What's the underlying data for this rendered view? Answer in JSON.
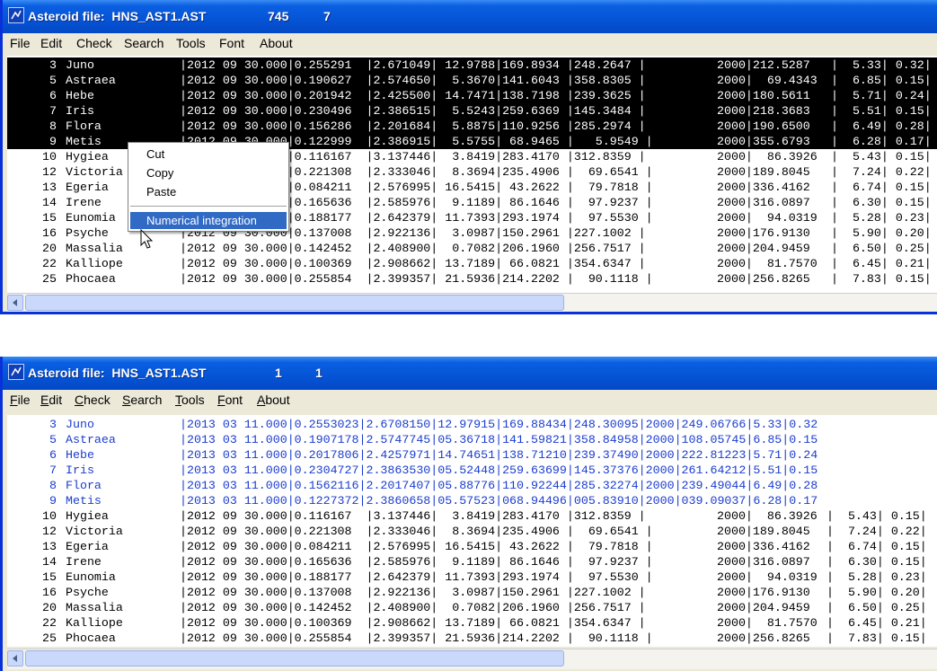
{
  "window_top": {
    "title": "Asteroid file:  HNS_AST1.AST",
    "num1": "745",
    "num2": "7",
    "menu": [
      "File",
      "Edit",
      "Check",
      "Search",
      "Tools",
      "Font",
      "About"
    ],
    "rows": [
      {
        "num": "3",
        "name": "Juno",
        "data": "|2012 09 30.000|0.255291  |2.671049| 12.9788|169.8934 |248.2647 |",
        "r1": "2000|212.5287",
        "r2": "|  5.33| 0.32|"
      },
      {
        "num": "5",
        "name": "Astraea",
        "data": "|2012 09 30.000|0.190627  |2.574650|  5.3670|141.6043 |358.8305 |",
        "r1": "2000|  69.4343",
        "r2": "|  6.85| 0.15|"
      },
      {
        "num": "6",
        "name": "Hebe",
        "data": "|2012 09 30.000|0.201942  |2.425500| 14.7471|138.7198 |239.3625 |",
        "r1": "2000|180.5611",
        "r2": "|  5.71| 0.24|"
      },
      {
        "num": "7",
        "name": "Iris",
        "data": "|2012 09 30.000|0.230496  |2.386515|  5.5243|259.6369 |145.3484 |",
        "r1": "2000|218.3683",
        "r2": "|  5.51| 0.15|"
      },
      {
        "num": "8",
        "name": "Flora",
        "data": "|2012 09 30.000|0.156286  |2.201684|  5.8875|110.9256 |285.2974 |",
        "r1": "2000|190.6500",
        "r2": "|  6.49| 0.28|"
      },
      {
        "num": "9",
        "name": "Metis",
        "data": "|2012 09 30.000|0.122999  |2.386915|  5.5755| 68.9465 |   5.9549 |",
        "r1": "2000|355.6793",
        "r2": "|  6.28| 0.17|"
      },
      {
        "num": "10",
        "name": "Hygiea",
        "data": "|2012 09 30.000|0.116167  |3.137446|  3.8419|283.4170 |312.8359 |",
        "r1": "2000|  86.3926",
        "r2": "|  5.43| 0.15|"
      },
      {
        "num": "12",
        "name": "Victoria",
        "data": "|2012 09 30.000|0.221308  |2.333046|  8.3694|235.4906 |  69.6541 |",
        "r1": "2000|189.8045",
        "r2": "|  7.24| 0.22|"
      },
      {
        "num": "13",
        "name": "Egeria",
        "data": "|2012 09 30.000|0.084211  |2.576995| 16.5415| 43.2622 |  79.7818 |",
        "r1": "2000|336.4162",
        "r2": "|  6.74| 0.15|"
      },
      {
        "num": "14",
        "name": "Irene",
        "data": "|2012 09 30.000|0.165636  |2.585976|  9.1189| 86.1646 |  97.9237 |",
        "r1": "2000|316.0897",
        "r2": "|  6.30| 0.15|"
      },
      {
        "num": "15",
        "name": "Eunomia",
        "data": "|2012 09 30.000|0.188177  |2.642379| 11.7393|293.1974 |  97.5530 |",
        "r1": "2000|  94.0319",
        "r2": "|  5.28| 0.23|"
      },
      {
        "num": "16",
        "name": "Psyche",
        "data": "|2012 09 30.000|0.137008  |2.922136|  3.0987|150.2961 |227.1002 |",
        "r1": "2000|176.9130",
        "r2": "|  5.90| 0.20|"
      },
      {
        "num": "20",
        "name": "Massalia",
        "data": "|2012 09 30.000|0.142452  |2.408900|  0.7082|206.1960 |256.7517 |",
        "r1": "2000|204.9459",
        "r2": "|  6.50| 0.25|"
      },
      {
        "num": "22",
        "name": "Kalliope",
        "data": "|2012 09 30.000|0.100369  |2.908662| 13.7189| 66.0821 |354.6347 |",
        "r1": "2000|  81.7570",
        "r2": "|  6.45| 0.21|"
      },
      {
        "num": "25",
        "name": "Phocaea",
        "data": "|2012 09 30.000|0.255854  |2.399357| 21.5936|214.2202 |  90.1118 |",
        "r1": "2000|256.8265",
        "r2": "|  7.83| 0.15|"
      }
    ],
    "context_menu": {
      "items": [
        "Cut",
        "Copy",
        "Paste"
      ],
      "highlighted": "Numerical integration"
    }
  },
  "window_bottom": {
    "title": "Asteroid file:  HNS_AST1.AST",
    "num1": "1",
    "num2": "1",
    "menu": [
      "File",
      "Edit",
      "Check",
      "Search",
      "Tools",
      "Font",
      "About"
    ],
    "rows": [
      {
        "num": "3",
        "name": "Juno",
        "data": "|2013 03 11.000|0.2553023|2.6708150|12.97915|169.88434|248.30095|2000|249.06766|5.33|0.32"
      },
      {
        "num": "5",
        "name": "Astraea",
        "data": "|2013 03 11.000|0.1907178|2.5747745|05.36718|141.59821|358.84958|2000|108.05745|6.85|0.15"
      },
      {
        "num": "6",
        "name": "Hebe",
        "data": "|2013 03 11.000|0.2017806|2.4257971|14.74651|138.71210|239.37490|2000|222.81223|5.71|0.24"
      },
      {
        "num": "7",
        "name": "Iris",
        "data": "|2013 03 11.000|0.2304727|2.3863530|05.52448|259.63699|145.37376|2000|261.64212|5.51|0.15"
      },
      {
        "num": "8",
        "name": "Flora",
        "data": "|2013 03 11.000|0.1562116|2.2017407|05.88776|110.92244|285.32274|2000|239.49044|6.49|0.28"
      },
      {
        "num": "9",
        "name": "Metis",
        "data": "|2013 03 11.000|0.1227372|2.3860658|05.57523|068.94496|005.83910|2000|039.09037|6.28|0.17"
      },
      {
        "num": "10",
        "name": "Hygiea",
        "data": "|2012 09 30.000|0.116167  |3.137446|  3.8419|283.4170 |312.8359 |",
        "r1": "2000|  86.3926",
        "r2": "|  5.43| 0.15|"
      },
      {
        "num": "12",
        "name": "Victoria",
        "data": "|2012 09 30.000|0.221308  |2.333046|  8.3694|235.4906 |  69.6541 |",
        "r1": "2000|189.8045",
        "r2": "|  7.24| 0.22|"
      },
      {
        "num": "13",
        "name": "Egeria",
        "data": "|2012 09 30.000|0.084211  |2.576995| 16.5415| 43.2622 |  79.7818 |",
        "r1": "2000|336.4162",
        "r2": "|  6.74| 0.15|"
      },
      {
        "num": "14",
        "name": "Irene",
        "data": "|2012 09 30.000|0.165636  |2.585976|  9.1189| 86.1646 |  97.9237 |",
        "r1": "2000|316.0897",
        "r2": "|  6.30| 0.15|"
      },
      {
        "num": "15",
        "name": "Eunomia",
        "data": "|2012 09 30.000|0.188177  |2.642379| 11.7393|293.1974 |  97.5530 |",
        "r1": "2000|  94.0319",
        "r2": "|  5.28| 0.23|"
      },
      {
        "num": "16",
        "name": "Psyche",
        "data": "|2012 09 30.000|0.137008  |2.922136|  3.0987|150.2961 |227.1002 |",
        "r1": "2000|176.9130",
        "r2": "|  5.90| 0.20|"
      },
      {
        "num": "20",
        "name": "Massalia",
        "data": "|2012 09 30.000|0.142452  |2.408900|  0.7082|206.1960 |256.7517 |",
        "r1": "2000|204.9459",
        "r2": "|  6.50| 0.25|"
      },
      {
        "num": "22",
        "name": "Kalliope",
        "data": "|2012 09 30.000|0.100369  |2.908662| 13.7189| 66.0821 |354.6347 |",
        "r1": "2000|  81.7570",
        "r2": "|  6.45| 0.21|"
      },
      {
        "num": "25",
        "name": "Phocaea",
        "data": "|2012 09 30.000|0.255854  |2.399357| 21.5936|214.2202 |  90.1118 |",
        "r1": "2000|256.8265",
        "r2": "|  7.83| 0.15|"
      }
    ]
  },
  "colors": {
    "title_bar": "#0554d6",
    "selection_bg": "#000000",
    "updated_text": "#1a3cd0",
    "menu_highlight": "#316ac5"
  },
  "icons": [
    "app-icon",
    "mouse-cursor-icon",
    "scroll-left-icon"
  ]
}
